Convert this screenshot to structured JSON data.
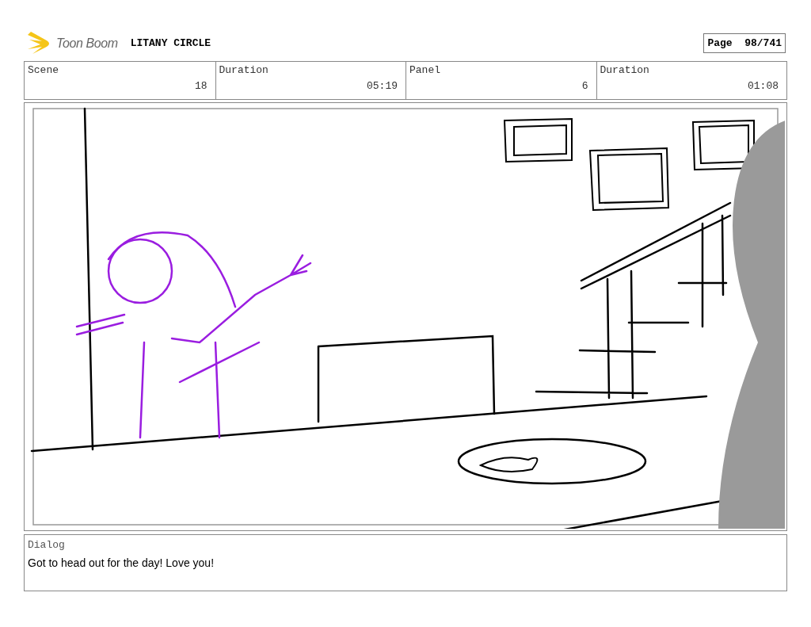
{
  "header": {
    "logo_text": "Toon Boom",
    "project_title": "LITANY CIRCLE",
    "page": "Page  98/741"
  },
  "fields": [
    {
      "label": "Scene",
      "value": "18"
    },
    {
      "label": "Duration",
      "value": "05:19"
    },
    {
      "label": "Panel",
      "value": "6"
    },
    {
      "label": "Duration",
      "value": "01:08"
    }
  ],
  "dialog": {
    "label": "Dialog",
    "text": "Got to head out for the day! Love you!"
  }
}
